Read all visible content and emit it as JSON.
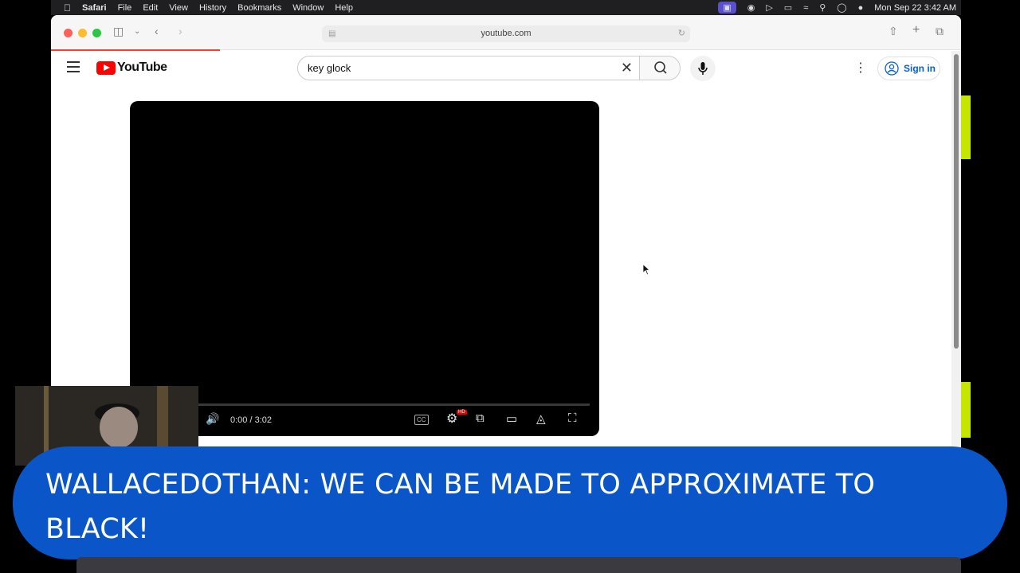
{
  "menubar": {
    "app": "Safari",
    "menus": [
      "File",
      "Edit",
      "View",
      "History",
      "Bookmarks",
      "Window",
      "Help"
    ],
    "clock": "Mon Sep 22  3:42 AM"
  },
  "browser": {
    "url": "youtube.com"
  },
  "youtube": {
    "logo_text": "YouTube",
    "search": {
      "value": "key glock"
    },
    "signin_label": "Sign in"
  },
  "player": {
    "time": "0:00 / 3:02",
    "hd_badge": "HD",
    "cc_label": "CC"
  },
  "caption": {
    "text": "WALLACEDOTHAN: WE CAN BE MADE TO APPROXIMATE TO BLACK!"
  },
  "colors": {
    "caption_bg": "#0a56c8",
    "youtube_red": "#ff0000",
    "signin_blue": "#065fd4"
  }
}
